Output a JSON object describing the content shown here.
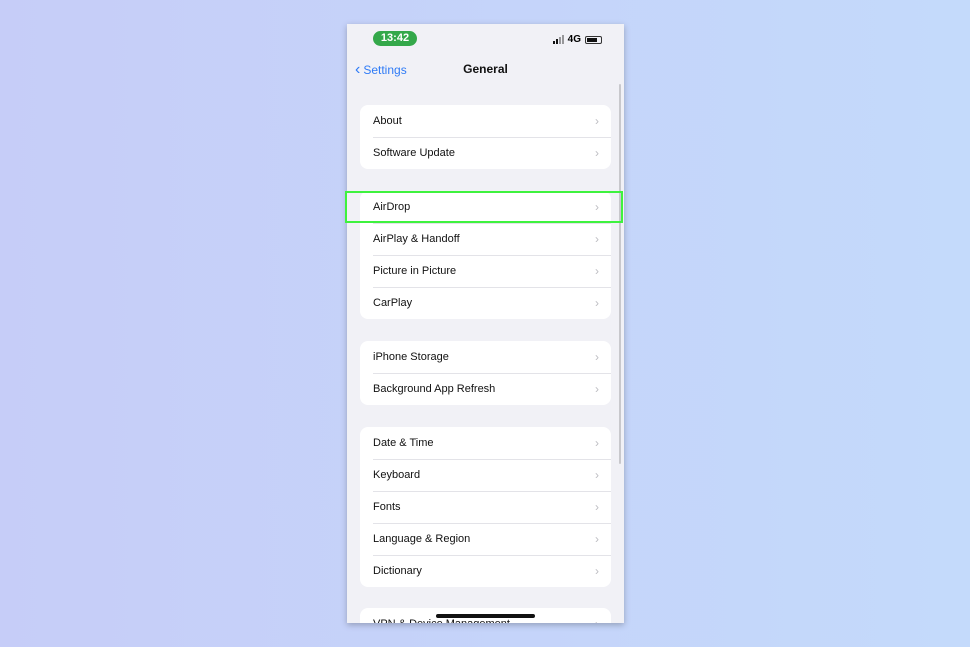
{
  "status": {
    "time": "13:42",
    "network": "4G"
  },
  "nav": {
    "back": "Settings",
    "title": "General"
  },
  "groups": [
    [
      "About",
      "Software Update"
    ],
    [
      "AirDrop",
      "AirPlay & Handoff",
      "Picture in Picture",
      "CarPlay"
    ],
    [
      "iPhone Storage",
      "Background App Refresh"
    ],
    [
      "Date & Time",
      "Keyboard",
      "Fonts",
      "Language & Region",
      "Dictionary"
    ],
    [
      "VPN & Device Management"
    ]
  ],
  "highlight": {
    "item": "AirDrop",
    "color": "#3ef23e"
  }
}
